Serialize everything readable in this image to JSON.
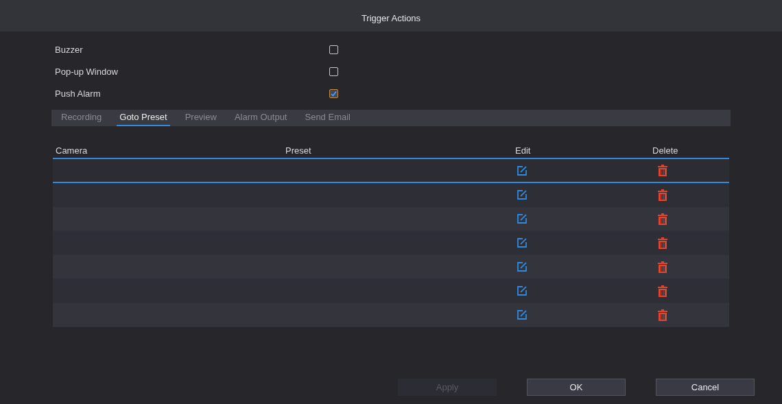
{
  "window": {
    "title": "Trigger Actions"
  },
  "options": [
    {
      "label": "Buzzer",
      "checked": false
    },
    {
      "label": "Pop-up Window",
      "checked": false
    },
    {
      "label": "Push Alarm",
      "checked": true
    }
  ],
  "tabs": [
    {
      "label": "Recording",
      "selected": false
    },
    {
      "label": "Goto Preset",
      "selected": true
    },
    {
      "label": "Preview",
      "selected": false
    },
    {
      "label": "Alarm Output",
      "selected": false
    },
    {
      "label": "Send Email",
      "selected": false
    }
  ],
  "table": {
    "columns": [
      "Camera",
      "Preset",
      "Edit",
      "Delete"
    ],
    "rows": [
      {
        "selected": true
      },
      {
        "selected": false
      },
      {
        "selected": false
      },
      {
        "selected": false
      },
      {
        "selected": false
      },
      {
        "selected": false
      },
      {
        "selected": false
      }
    ]
  },
  "buttons": [
    {
      "label": "Apply",
      "disabled": true
    },
    {
      "label": "OK",
      "disabled": false
    },
    {
      "label": "Cancel",
      "disabled": false
    }
  ]
}
